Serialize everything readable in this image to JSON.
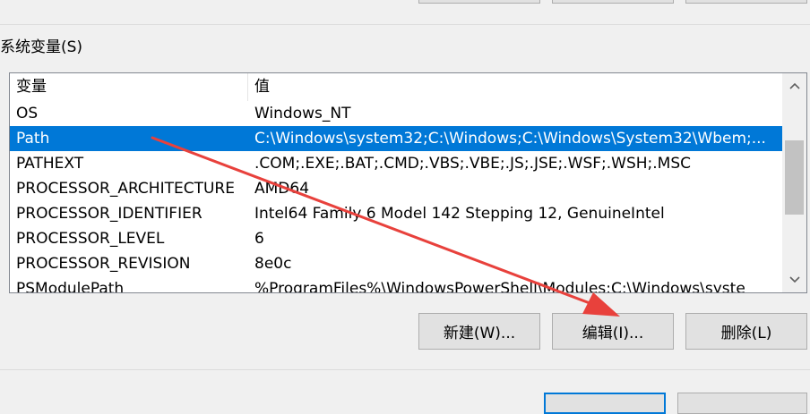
{
  "group_label": "系统变量(S)",
  "list": {
    "headers": {
      "variable": "变量",
      "value": "值"
    },
    "rows": [
      {
        "name": "OS",
        "value": "Windows_NT",
        "selected": false
      },
      {
        "name": "Path",
        "value": "C:\\Windows\\system32;C:\\Windows;C:\\Windows\\System32\\Wbem;...",
        "selected": true
      },
      {
        "name": "PATHEXT",
        "value": ".COM;.EXE;.BAT;.CMD;.VBS;.VBE;.JS;.JSE;.WSF;.WSH;.MSC",
        "selected": false
      },
      {
        "name": "PROCESSOR_ARCHITECTURE",
        "value": "AMD64",
        "selected": false
      },
      {
        "name": "PROCESSOR_IDENTIFIER",
        "value": "Intel64 Family 6 Model 142 Stepping 12, GenuineIntel",
        "selected": false
      },
      {
        "name": "PROCESSOR_LEVEL",
        "value": "6",
        "selected": false
      },
      {
        "name": "PROCESSOR_REVISION",
        "value": "8e0c",
        "selected": false
      },
      {
        "name": "PSModulePath",
        "value": "%ProgramFiles%\\WindowsPowerShell\\Modules;C:\\Windows\\syste",
        "selected": false
      }
    ]
  },
  "buttons": {
    "new_label": "新建(W)...",
    "edit_label": "编辑(I)...",
    "delete_label": "删除(L)"
  },
  "colors": {
    "selection": "#0078d7",
    "annotation_arrow": "#e8413c"
  },
  "icons": {
    "scroll_up": "scroll-up-arrow-icon",
    "scroll_down": "scroll-down-arrow-icon"
  }
}
